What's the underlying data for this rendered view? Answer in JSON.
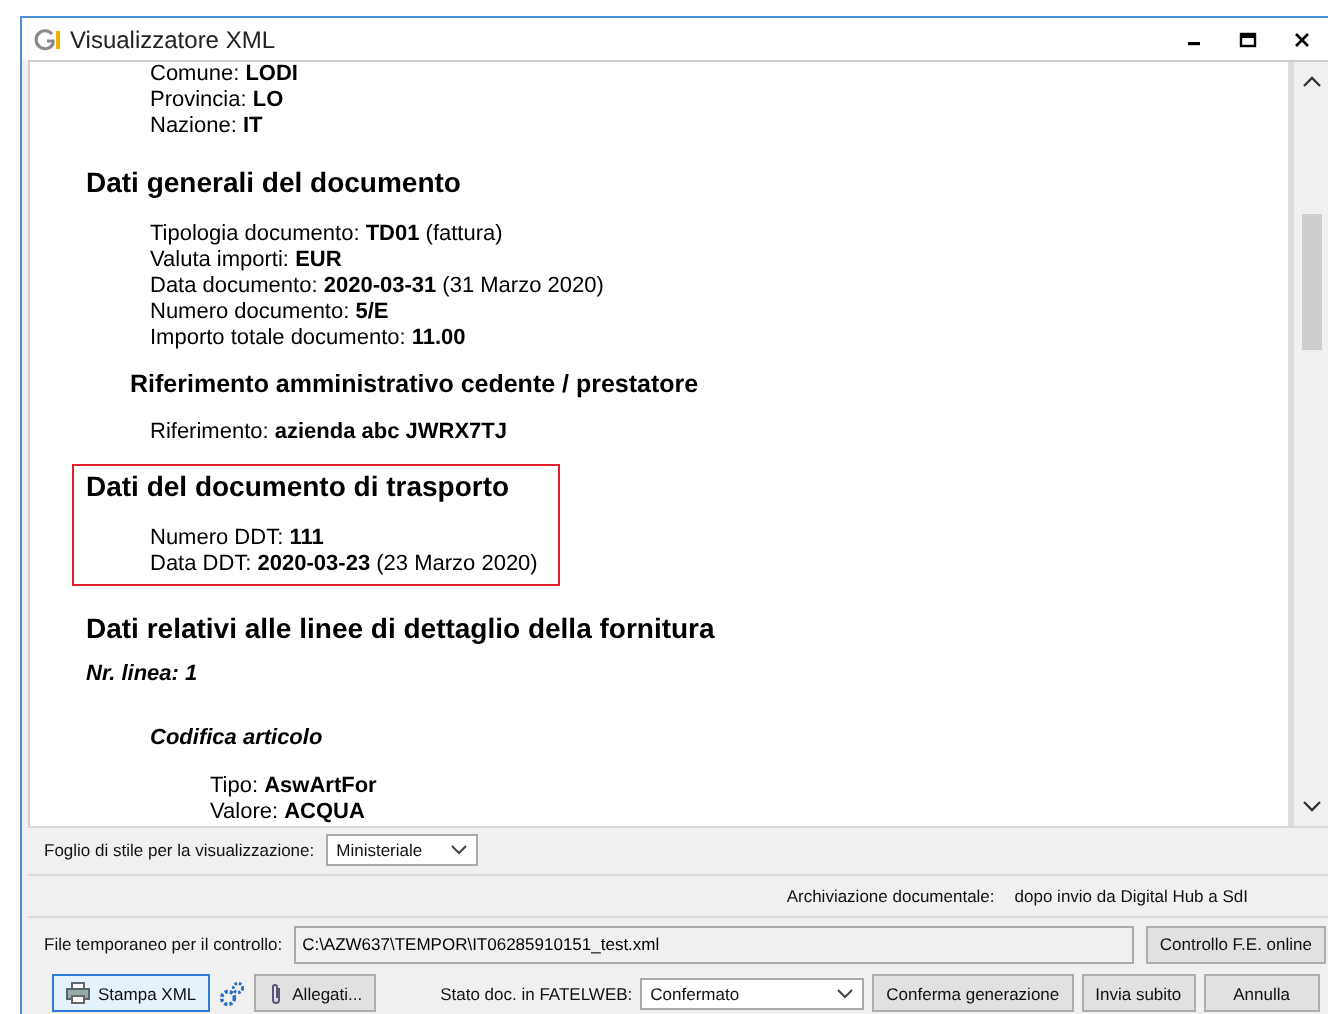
{
  "window": {
    "title": "Visualizzatore XML"
  },
  "document": [
    {
      "kind": "fields",
      "lines": [
        "Comune: **LODI**",
        "Provincia: **LO**",
        "Nazione: **IT**"
      ]
    },
    {
      "kind": "heading",
      "text": "Dati generali del documento"
    },
    {
      "kind": "fields",
      "lines": [
        "Tipologia documento: **TD01** (fattura)",
        "Valuta importi: **EUR**",
        "Data documento: **2020-03-31** (31 Marzo 2020)",
        "Numero documento: **5/E**",
        "Importo totale documento: **11.00**"
      ]
    },
    {
      "kind": "subheading",
      "text": "Riferimento amministrativo cedente / prestatore"
    },
    {
      "kind": "fields",
      "lines": [
        "Riferimento: **azienda abc JWRX7TJ**"
      ]
    },
    {
      "kind": "box",
      "highlighted": true,
      "children": [
        {
          "kind": "heading",
          "text": "Dati del documento di trasporto"
        },
        {
          "kind": "fields",
          "lines": [
            "Numero DDT: **111**",
            "Data DDT: **2020-03-23** (23 Marzo 2020)"
          ]
        }
      ]
    },
    {
      "kind": "heading",
      "text": "Dati relativi alle linee di dettaglio della fornitura"
    },
    {
      "kind": "label",
      "text": "Nr. linea: 1"
    },
    {
      "kind": "group",
      "text": "Codifica articolo"
    },
    {
      "kind": "subfields",
      "lines": [
        "Tipo: **AswArtFor**",
        "Valore: **ACQUA**"
      ]
    }
  ],
  "stylesheet": {
    "label": "Foglio di stile per la visualizzazione:",
    "value": "Ministeriale"
  },
  "archive": {
    "label": "Archiviazione documentale:",
    "value": "dopo invio da Digital Hub a SdI"
  },
  "temp_file": {
    "label": "File temporaneo per il controllo:",
    "value": "C:\\AZW637\\TEMPOR\\IT06285910151_test.xml",
    "button": "Controllo F.E. online"
  },
  "toolbar": {
    "print": "Stampa XML",
    "attachments": "Allegati...",
    "status_label": "Stato doc. in FATELWEB:",
    "status_value": "Confermato",
    "buttons": [
      "Conferma generazione",
      "Invia subito",
      "Annulla"
    ]
  }
}
